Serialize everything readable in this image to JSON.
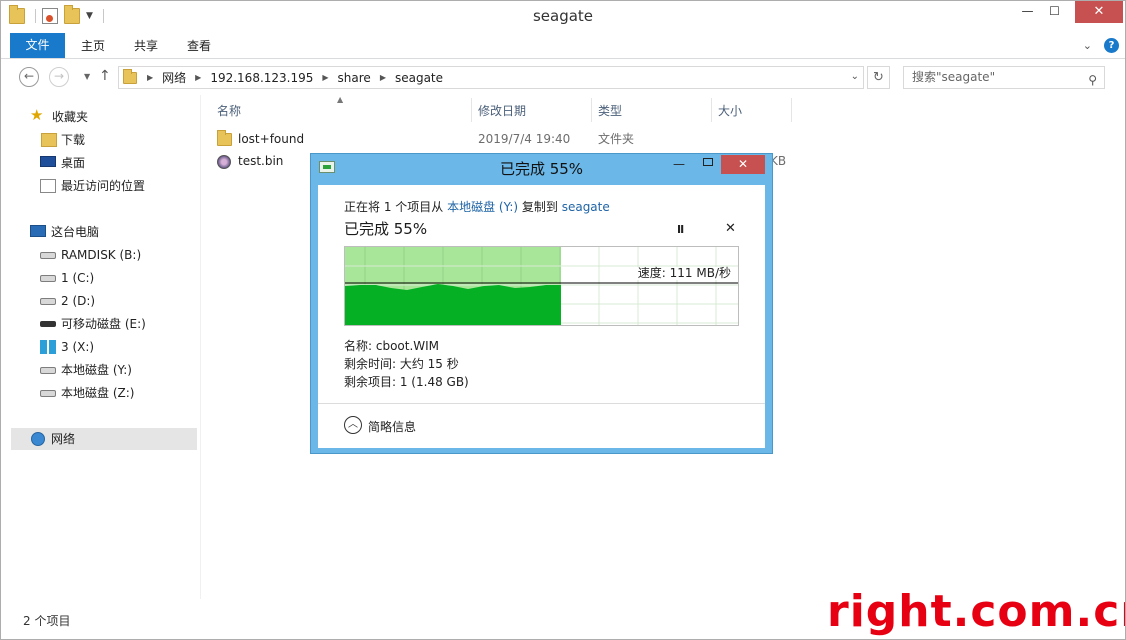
{
  "window": {
    "title": "seagate",
    "minimize": "—",
    "maximize": "☐",
    "close": "✕"
  },
  "ribbon": {
    "tabs": [
      "文件",
      "主页",
      "共享",
      "查看"
    ]
  },
  "address": {
    "crumbs": [
      "网络",
      "192.168.123.195",
      "share",
      "seagate"
    ],
    "search_placeholder": "搜索\"seagate\""
  },
  "sidebar": {
    "items": [
      {
        "label": "收藏夹",
        "icon": "star-icon"
      },
      {
        "label": "下载",
        "icon": "downloads-icon"
      },
      {
        "label": "桌面",
        "icon": "desktop-icon"
      },
      {
        "label": "最近访问的位置",
        "icon": "recent-places-icon"
      },
      {
        "label": "这台电脑",
        "icon": "computer-icon"
      },
      {
        "label": "RAMDISK (B:)",
        "icon": "drive-icon"
      },
      {
        "label": "1 (C:)",
        "icon": "drive-icon"
      },
      {
        "label": "2 (D:)",
        "icon": "drive-icon"
      },
      {
        "label": "可移动磁盘 (E:)",
        "icon": "removable-drive-icon"
      },
      {
        "label": "3 (X:)",
        "icon": "windows-drive-icon"
      },
      {
        "label": "本地磁盘 (Y:)",
        "icon": "drive-icon"
      },
      {
        "label": "本地磁盘 (Z:)",
        "icon": "drive-icon"
      },
      {
        "label": "网络",
        "icon": "network-icon"
      }
    ]
  },
  "file_list": {
    "columns": [
      "名称",
      "修改日期",
      "类型",
      "大小"
    ],
    "rows": [
      {
        "name": "lost+found",
        "date": "2019/7/4 19:40",
        "type": "文件夹",
        "size": "",
        "icon": "folder-icon"
      },
      {
        "name": "test.bin",
        "date": "",
        "type": "",
        "size": "KB",
        "icon": "bin-file-icon"
      }
    ]
  },
  "status": {
    "item_count": "2 个项目"
  },
  "watermark": "right.com.cn",
  "copy_dialog": {
    "title": "已完成 55%",
    "line_prefix": "正在将 1 个项目从 ",
    "source": "本地磁盘 (Y:)",
    "line_mid": " 复制到 ",
    "destination": "seagate",
    "heading": "已完成 55%",
    "progress": 0.55,
    "pause": "II",
    "cancel": "✕",
    "speed": "速度: 111 MB/秒",
    "name_line": "名称: cboot.WIM",
    "time_line": "剩余时间: 大约 15 秒",
    "items_line": "剩余项目: 1 (1.48 GB)",
    "toggle_label": "简略信息",
    "colors": {
      "done_light": "#a8e69a",
      "done_dark": "#06b025",
      "grid": "#d7ebd3",
      "speed_line": "#000000"
    }
  }
}
